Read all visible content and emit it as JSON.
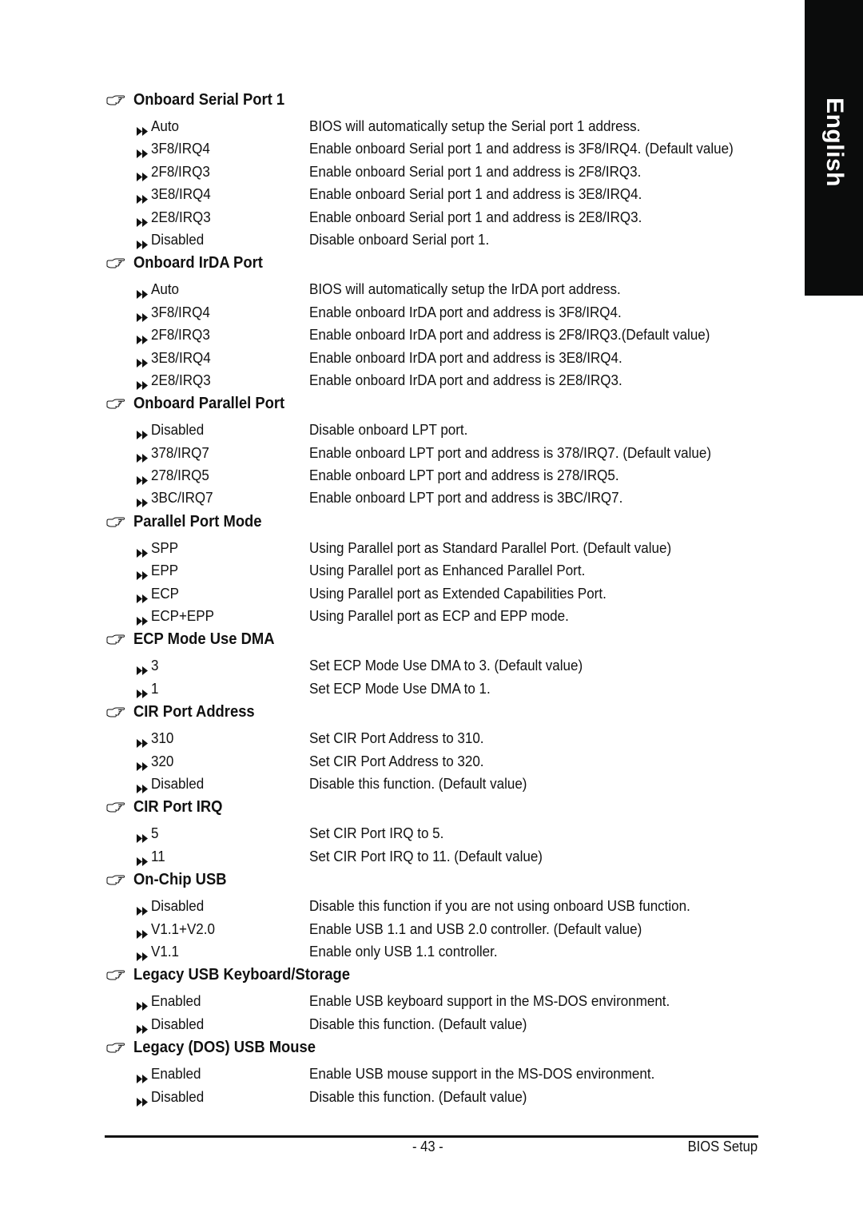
{
  "side_tab": {
    "label": "English"
  },
  "sections": [
    {
      "title": "Onboard Serial Port 1",
      "options": [
        {
          "value": "Auto",
          "description": "BIOS will automatically setup the Serial port 1 address."
        },
        {
          "value": "3F8/IRQ4",
          "description": "Enable onboard Serial port 1 and address is 3F8/IRQ4. (Default value)"
        },
        {
          "value": "2F8/IRQ3",
          "description": "Enable onboard Serial port 1 and address is 2F8/IRQ3."
        },
        {
          "value": "3E8/IRQ4",
          "description": "Enable onboard Serial port 1 and address is 3E8/IRQ4."
        },
        {
          "value": "2E8/IRQ3",
          "description": "Enable onboard Serial port 1 and address is 2E8/IRQ3."
        },
        {
          "value": "Disabled",
          "description": "Disable onboard Serial port 1."
        }
      ]
    },
    {
      "title": "Onboard IrDA Port",
      "options": [
        {
          "value": "Auto",
          "description": "BIOS will automatically setup the IrDA port address."
        },
        {
          "value": "3F8/IRQ4",
          "description": "Enable onboard IrDA port and address is 3F8/IRQ4."
        },
        {
          "value": "2F8/IRQ3",
          "description": "Enable onboard IrDA port and address is 2F8/IRQ3.(Default value)"
        },
        {
          "value": "3E8/IRQ4",
          "description": "Enable onboard IrDA port and address is 3E8/IRQ4."
        },
        {
          "value": "2E8/IRQ3",
          "description": "Enable onboard IrDA port and address is 2E8/IRQ3."
        }
      ]
    },
    {
      "title": "Onboard Parallel Port",
      "options": [
        {
          "value": "Disabled",
          "description": "Disable onboard LPT port."
        },
        {
          "value": "378/IRQ7",
          "description": "Enable onboard LPT port and address is 378/IRQ7. (Default value)"
        },
        {
          "value": "278/IRQ5",
          "description": "Enable onboard LPT port and address is 278/IRQ5."
        },
        {
          "value": "3BC/IRQ7",
          "description": "Enable onboard LPT port and address is 3BC/IRQ7."
        }
      ]
    },
    {
      "title": "Parallel Port Mode",
      "options": [
        {
          "value": "SPP",
          "description": "Using Parallel port as Standard Parallel Port. (Default value)"
        },
        {
          "value": "EPP",
          "description": "Using Parallel port as Enhanced Parallel Port."
        },
        {
          "value": "ECP",
          "description": "Using Parallel port as Extended Capabilities Port."
        },
        {
          "value": "ECP+EPP",
          "description": "Using Parallel port as ECP and EPP mode."
        }
      ]
    },
    {
      "title": "ECP Mode Use DMA",
      "options": [
        {
          "value": "3",
          "description": "Set ECP Mode Use DMA to 3. (Default value)"
        },
        {
          "value": "1",
          "description": "Set ECP Mode Use DMA to 1."
        }
      ]
    },
    {
      "title": "CIR Port Address",
      "options": [
        {
          "value": "310",
          "description": "Set CIR Port Address to 310."
        },
        {
          "value": "320",
          "description": "Set CIR Port Address to 320."
        },
        {
          "value": "Disabled",
          "description": "Disable this function. (Default value)"
        }
      ]
    },
    {
      "title": "CIR Port IRQ",
      "options": [
        {
          "value": "5",
          "description": "Set CIR Port IRQ to 5."
        },
        {
          "value": "11",
          "description": "Set CIR Port IRQ to 11. (Default value)"
        }
      ]
    },
    {
      "title": "On-Chip USB",
      "options": [
        {
          "value": "Disabled",
          "description": "Disable this function if you are not using onboard USB function."
        },
        {
          "value": "V1.1+V2.0",
          "description": "Enable USB 1.1 and USB 2.0 controller. (Default value)"
        },
        {
          "value": "V1.1",
          "description": "Enable only USB 1.1 controller."
        }
      ]
    },
    {
      "title": "Legacy USB Keyboard/Storage",
      "options": [
        {
          "value": "Enabled",
          "description": "Enable USB keyboard support in the MS-DOS environment."
        },
        {
          "value": "Disabled",
          "description": "Disable this function. (Default value)"
        }
      ]
    },
    {
      "title": "Legacy (DOS) USB Mouse",
      "options": [
        {
          "value": "Enabled",
          "description": "Enable USB mouse support in the MS-DOS environment."
        },
        {
          "value": "Disabled",
          "description": "Disable this function. (Default value)"
        }
      ]
    }
  ],
  "footer": {
    "page_number": "- 43 -",
    "chapter": "BIOS Setup"
  },
  "icons": {
    "section_bullet": "pointing-hand-icon",
    "option_bullet": "double-right-arrow-icon"
  },
  "colors": {
    "text": "#111111",
    "side_tab_bg": "#0b0c0c",
    "side_tab_text": "#ffffff"
  }
}
